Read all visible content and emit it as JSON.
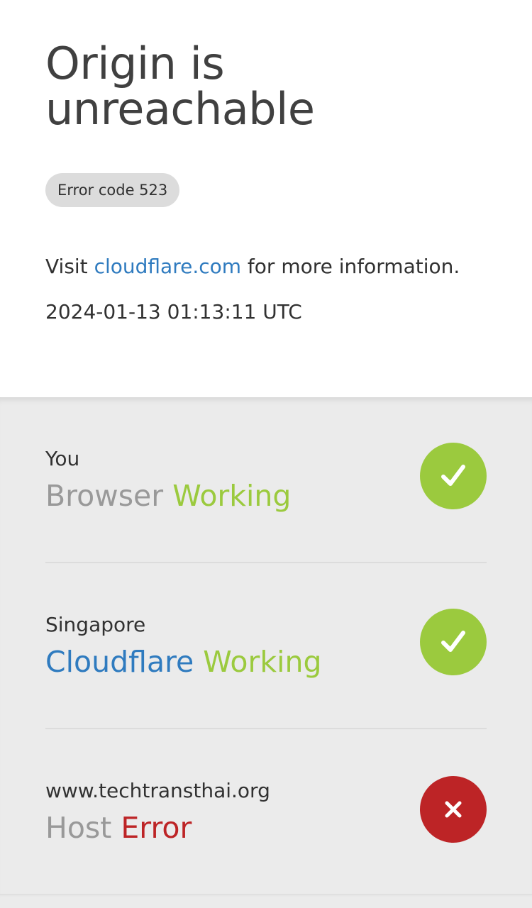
{
  "header": {
    "title_line1": "Origin is",
    "title_line2": "unreachable",
    "error_badge": "Error code 523",
    "info_prefix": "Visit ",
    "info_link": "cloudflare.com",
    "info_suffix": " for more information.",
    "timestamp": "2024-01-13 01:13:11 UTC"
  },
  "status": {
    "browser": {
      "location": "You",
      "name": "Browser",
      "state": "Working",
      "icon": "check-icon"
    },
    "cloudflare": {
      "location": "Singapore",
      "name": "Cloudflare",
      "state": "Working",
      "icon": "check-icon"
    },
    "host": {
      "location": "www.techtransthai.org",
      "name": "Host",
      "state": "Error",
      "icon": "x-icon"
    }
  },
  "colors": {
    "ok": "#9bca3e",
    "error": "#bd2426",
    "link": "#2f7bbf"
  }
}
